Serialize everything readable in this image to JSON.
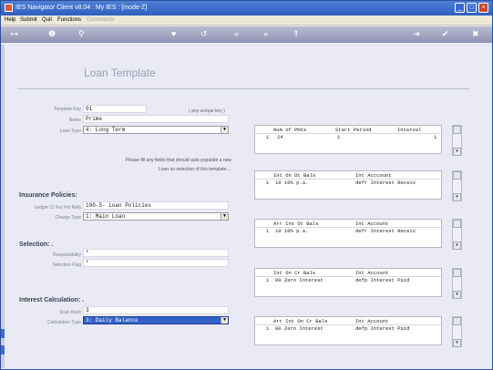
{
  "window": {
    "title": "IES Navigator Client v8.04 : My IES :     [mode-Z]",
    "controls": [
      "_",
      "□",
      "×"
    ]
  },
  "menu": {
    "items": [
      "Help",
      "Submit",
      "Quit",
      "Functions"
    ],
    "disabled_item": "Commands"
  },
  "toolbar": {
    "icons": [
      "key-icon",
      "info-icon",
      "search-icon",
      "heart-icon",
      "undo-icon",
      "back-icon",
      "forward-icon",
      "expand-icon",
      "forward-step-icon",
      "check-icon",
      "close-icon"
    ],
    "glyphs": [
      "⊶",
      "❶",
      "⚲",
      "♥",
      "↺",
      "«",
      "»",
      "⇑",
      "⇥",
      "✔",
      "✖"
    ]
  },
  "page": {
    "title": "Loan Template"
  },
  "fields": {
    "template_key_label": "Template Key",
    "template_key_value": "01",
    "template_key_hint": "( any unique key )",
    "name_label": "Name",
    "name_value": "Prime",
    "loan_type_label": "Loan Type",
    "loan_type_value": "4: Long Term",
    "note": "Please fill any fields that should auto populate a new Loan on selection of this template...."
  },
  "insurance": {
    "section_title": "Insurance Policies:",
    "ledger_label": "Ledger Cr For Pol Refs",
    "ledger_value": "100-5- Loan Policies",
    "charge_type_label": "Charge Type",
    "charge_type_value": "1: Main Loan"
  },
  "selection": {
    "section_title": "Selection: .",
    "responsibility_label": "Responsibility",
    "responsibility_value": "*",
    "selection_flag_label": "Selection Flag",
    "selection_flag_value": "*"
  },
  "interest": {
    "section_title": "Interest Calculation: .",
    "scan_back_label": "Scan Back",
    "scan_back_value": "3",
    "calc_type_label": "Calculation Type",
    "calc_type_value": "3: Daily Balance"
  },
  "grids": [
    {
      "headers": [
        "Num of Pmts",
        "Start Period",
        "Interval"
      ],
      "row_num": "1",
      "cells": [
        "24",
        "1",
        "1"
      ]
    },
    {
      "headers": [
        "Int On Dt Bals",
        "Int Acccount"
      ],
      "row_num": "1",
      "cells": [
        "10 10% p.a.",
        "defr Interest Receiv"
      ]
    },
    {
      "headers": [
        "Arr Int Dt Bals",
        "Int Account"
      ],
      "row_num": "1",
      "cells": [
        "10 10% p.a.",
        "defr Interest Receiv"
      ]
    },
    {
      "headers": [
        "Int On Cr Bals",
        "Int Account"
      ],
      "row_num": "1",
      "cells": [
        "00 Zero Interest",
        "defp Interest Paid"
      ]
    },
    {
      "headers": [
        "Arr Int On Cr Bals",
        "Int Account"
      ],
      "row_num": "1",
      "cells": [
        "00 Zero Interest",
        "defp Interest Paid"
      ]
    }
  ]
}
